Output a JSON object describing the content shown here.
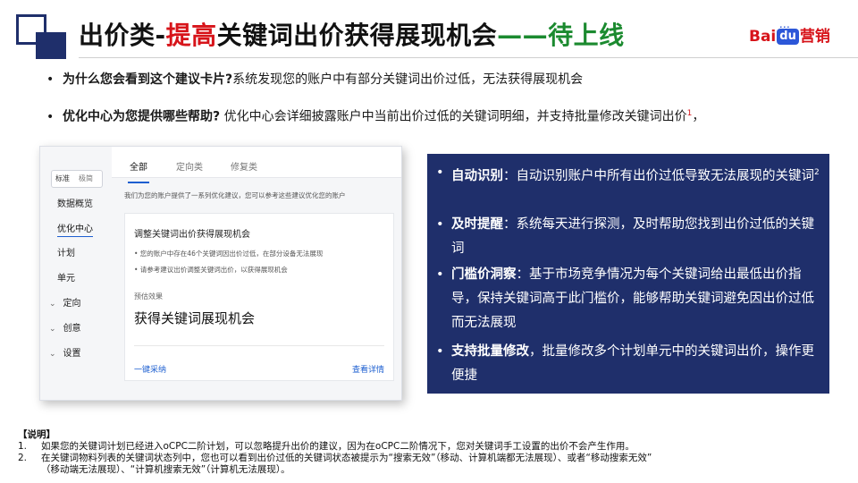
{
  "header": {
    "title_part1": "出价类-",
    "title_part2": "提高",
    "title_part3": "关键词出价获得展现机会",
    "title_part4": "——待上线",
    "brand": {
      "bai": "Bai",
      "du": "du",
      "paw": "···",
      "ying": "营销"
    }
  },
  "bullets": [
    {
      "q": "为什么您会看到这个建议卡片?",
      "a": "系统发现您的账户中有部分关键词出价过低，无法获得展现机会",
      "sup": ""
    },
    {
      "q": "优化中心为您提供哪些帮助?",
      "a": "优化中心会详细披露账户中当前出价过低的关键词明细，并支持批量修改关键词出价",
      "sup": "1",
      "tail": "，"
    }
  ],
  "screenshot": {
    "toggle": {
      "a": "标准",
      "b": "极简"
    },
    "sidebar": [
      "数据概览",
      "优化中心",
      "计划",
      "单元"
    ],
    "sidebar_sub": [
      "定向",
      "创意",
      "设置"
    ],
    "chevron": "⌄",
    "tabs": [
      "全部",
      "定向类",
      "修复类"
    ],
    "description": "我们为您的账户提供了一系列优化建议，您可以参考这些建议优化您的账户",
    "card": {
      "title": "调整关键词出价获得展现机会",
      "line1": "• 您的账户中存在46个关键词因出价过低，在部分设备无法展现",
      "line2": "• 请参考建议出价调整关键词出价，以获得展现机会",
      "sub": "预估效果",
      "big": "获得关键词展现机会",
      "link_left": "一键采纳",
      "link_right": "查看详情"
    }
  },
  "features": [
    {
      "kw": "自动识别",
      "sep": "：",
      "text": "自动识别账户中所有出价过低导致无法展现的关键词",
      "sup": "2"
    },
    {
      "kw": "及时提醒",
      "sep": "：",
      "text": "系统每天进行探测，及时帮助您找到出价过低的关键词",
      "sup": ""
    },
    {
      "kw": "门槛价洞察",
      "sep": "：",
      "text": "基于市场竞争情况为每个关键词给出最低出价指导，保持关键词高于此门槛价，能够帮助关键词避免因出价过低而无法展现",
      "sup": ""
    },
    {
      "kw": "支持批量修改",
      "sep": "，",
      "text": "批量修改多个计划单元中的关键词出价，操作更便捷",
      "sup": ""
    }
  ],
  "notes": {
    "heading": "【说明】",
    "items": [
      {
        "num": "1.",
        "text": "如果您的关键词计划已经进入oCPC二阶计划，可以忽略提升出价的建议，因为在oCPC二阶情况下，您对关键词手工设置的出价不会产生作用。"
      },
      {
        "num": "2.",
        "text": "在关键词物料列表的关键词状态列中，您也可以看到出价过低的关键词状态被提示为“搜索无效”（移动、计算机端都无法展现）、或者“移动搜索无效”"
      },
      {
        "num": "",
        "text": "（移动端无法展现）、“计算机搜索无效”（计算机无法展现）。"
      }
    ]
  },
  "colors": {
    "navy": "#1f2f6b",
    "red": "#d7141a",
    "green": "#1b8a2f",
    "link_blue": "#1d5fd0"
  }
}
